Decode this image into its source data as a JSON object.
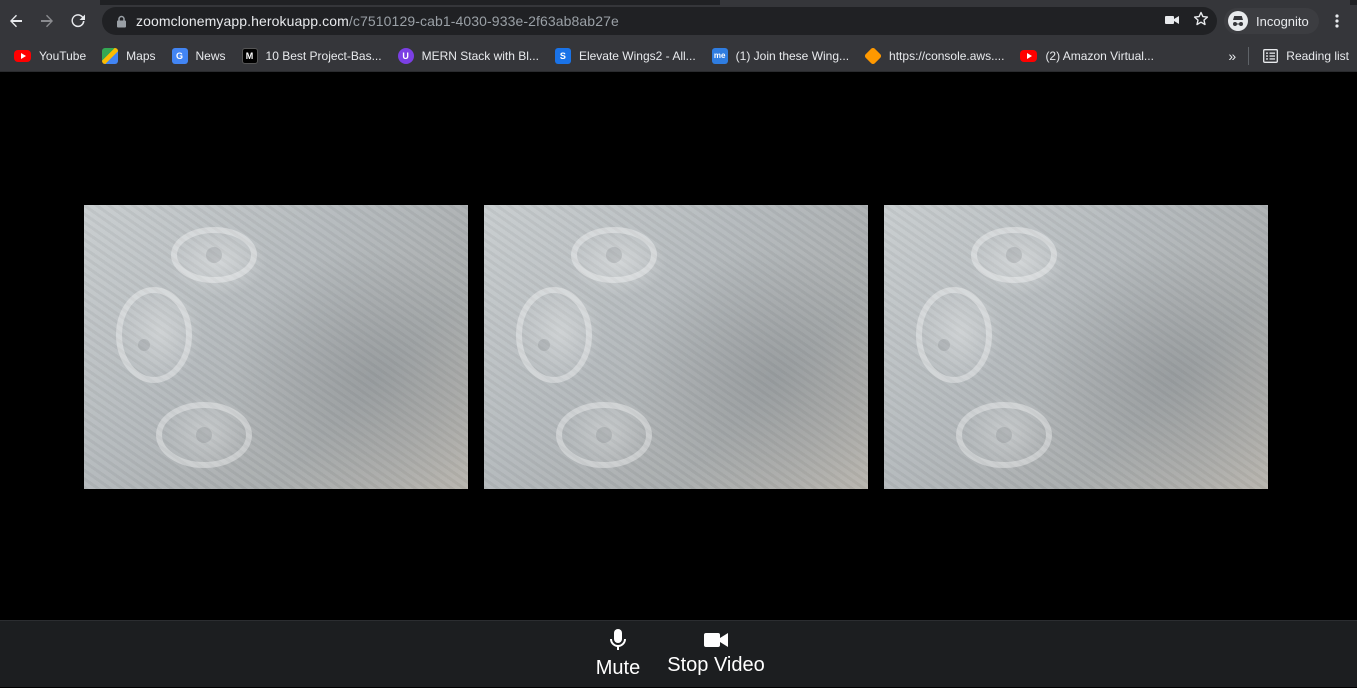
{
  "browser": {
    "url_domain": "zoomclonemyapp.herokuapp.com",
    "url_path": "/c7510129-cab1-4030-933e-2f63ab8ab27e",
    "profile_label": "Incognito"
  },
  "bookmarks": [
    {
      "label": "YouTube",
      "icon": "youtube-icon",
      "color": "#ff0000"
    },
    {
      "label": "Maps",
      "icon": "maps-icon",
      "color": "#34a853"
    },
    {
      "label": "News",
      "icon": "news-icon",
      "color": "#4285f4"
    },
    {
      "label": "10 Best Project-Bas...",
      "icon": "medium-icon",
      "color": "#000000"
    },
    {
      "label": "MERN Stack with Bl...",
      "icon": "mern-icon",
      "color": "#7b3fe4"
    },
    {
      "label": "Elevate Wings2 - All...",
      "icon": "elevate-icon",
      "color": "#1a73e8"
    },
    {
      "label": "(1) Join these Wing...",
      "icon": "me-icon",
      "color": "#2f7de1"
    },
    {
      "label": "https://console.aws....",
      "icon": "aws-icon",
      "color": "#ff9900"
    },
    {
      "label": "(2) Amazon Virtual...",
      "icon": "youtube-icon",
      "color": "#ff0000"
    }
  ],
  "bookmarks_right": {
    "reading_list": "Reading list"
  },
  "controls": {
    "mute_label": "Mute",
    "stop_video_label": "Stop Video"
  }
}
